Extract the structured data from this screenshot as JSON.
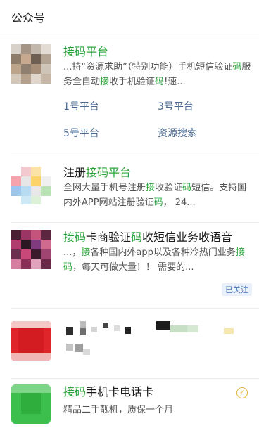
{
  "section_title": "公众号",
  "results": [
    {
      "title": [
        {
          "t": "接码平台",
          "h": true
        }
      ],
      "desc": [
        {
          "t": "...持“资源求助”（特别功能）手机短信验证",
          "h": false
        },
        {
          "t": "码",
          "h": true
        },
        {
          "t": "服务全自动",
          "h": false
        },
        {
          "t": "接",
          "h": true
        },
        {
          "t": "收手机验证",
          "h": false
        },
        {
          "t": "码",
          "h": true
        },
        {
          "t": "!速...",
          "h": false
        }
      ],
      "links": [
        "1号平台",
        "3号平台",
        "5号平台",
        "资源搜索"
      ]
    },
    {
      "title": [
        {
          "t": "注册",
          "h": false
        },
        {
          "t": "接码平台",
          "h": true
        }
      ],
      "desc": [
        {
          "t": "全网大量手机号注册",
          "h": false
        },
        {
          "t": "接",
          "h": true
        },
        {
          "t": "收验证",
          "h": false
        },
        {
          "t": "码",
          "h": true
        },
        {
          "t": "短信。支持国内外APP网站注册验证",
          "h": false
        },
        {
          "t": "码",
          "h": true
        },
        {
          "t": "， 24...",
          "h": false
        }
      ]
    },
    {
      "title": [
        {
          "t": "接码",
          "h": true
        },
        {
          "t": "卡商验证",
          "h": false
        },
        {
          "t": "码",
          "h": true
        },
        {
          "t": "收短信业务收语音",
          "h": false
        }
      ],
      "desc": [
        {
          "t": "...，",
          "h": false
        },
        {
          "t": "接",
          "h": true
        },
        {
          "t": "各种国内外app以及各种冷热门业务",
          "h": false
        },
        {
          "t": "接码",
          "h": true
        },
        {
          "t": "，每天可做大量！！ 需要的...",
          "h": false
        }
      ],
      "badge": "已关注"
    },
    {
      "title": [],
      "desc": []
    },
    {
      "title": [
        {
          "t": "接码",
          "h": true
        },
        {
          "t": "手机卡电话卡",
          "h": false
        }
      ],
      "desc": [
        {
          "t": "精品二手靓机，质保一个月",
          "h": false
        }
      ]
    }
  ]
}
